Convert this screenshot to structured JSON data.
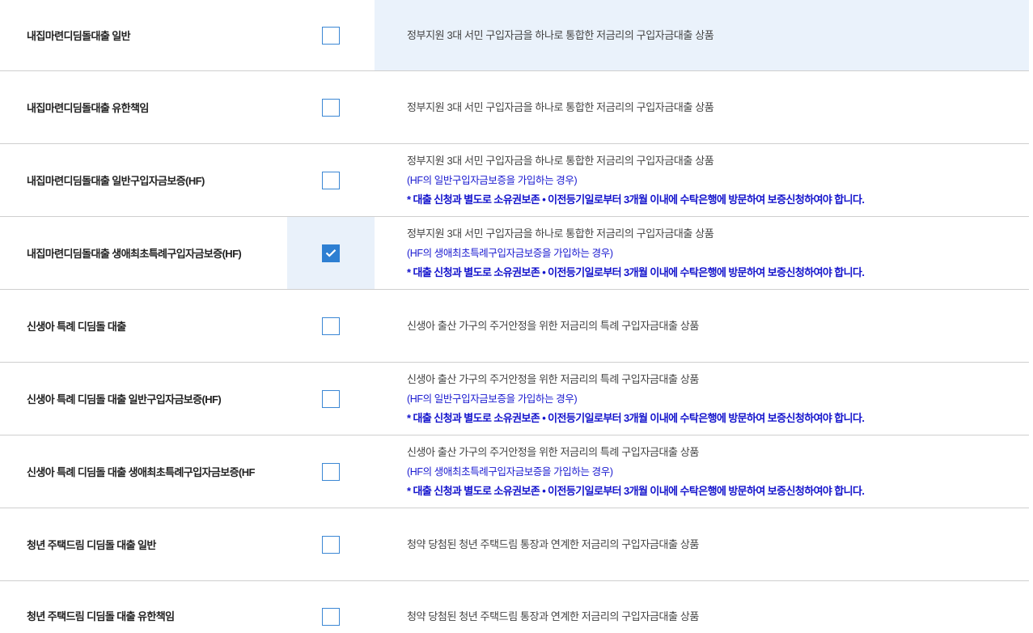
{
  "colors": {
    "accent": "#2e7fd2",
    "note_blue": "#1212cc",
    "highlight_bg": "#eaf2fb",
    "divider": "#cfcfcf"
  },
  "products": [
    {
      "name": "내집마련디딤돌대출 일반",
      "checked": false,
      "description": "정부지원 3대 서민 구입자금을 하나로 통합한 저금리의 구입자금대출 상품"
    },
    {
      "name": "내집마련디딤돌대출 유한책임",
      "checked": false,
      "description": "정부지원 3대 서민 구입자금을 하나로 통합한 저금리의 구입자금대출 상품"
    },
    {
      "name": "내집마련디딤돌대출 일반구입자금보증(HF)",
      "checked": false,
      "description": "정부지원 3대 서민 구입자금을 하나로 통합한 저금리의 구입자금대출 상품",
      "guarantee_note": "(HF의 일반구입자금보증을 가입하는 경우)",
      "notice": "* 대출 신청과 별도로 소유권보존 • 이전등기일로부터 3개월 이내에 수탁은행에 방문하여 보증신청하여야 합니다."
    },
    {
      "name": "내집마련디딤돌대출 생애최초특례구입자금보증(HF)",
      "checked": true,
      "description": "정부지원 3대 서민 구입자금을 하나로 통합한 저금리의 구입자금대출 상품",
      "guarantee_note": "(HF의 생애최초특례구입자금보증을 가입하는 경우)",
      "notice": "* 대출 신청과 별도로 소유권보존 • 이전등기일로부터 3개월 이내에 수탁은행에 방문하여 보증신청하여야 합니다."
    },
    {
      "name": "신생아 특례 디딤돌 대출",
      "checked": false,
      "description": "신생아 출산 가구의 주거안정을 위한 저금리의 특례 구입자금대출 상품"
    },
    {
      "name": "신생아 특례 디딤돌 대출 일반구입자금보증(HF)",
      "checked": false,
      "description": "신생아 출산 가구의 주거안정을 위한 저금리의 특례 구입자금대출 상품",
      "guarantee_note": "(HF의 일반구입자금보증을 가입하는 경우)",
      "notice": "* 대출 신청과 별도로 소유권보존 • 이전등기일로부터 3개월 이내에 수탁은행에 방문하여 보증신청하여야 합니다."
    },
    {
      "name": "신생아 특례 디딤돌 대출 생애최초특례구입자금보증(HF",
      "checked": false,
      "description": "신생아 출산 가구의 주거안정을 위한 저금리의 특례 구입자금대출 상품",
      "guarantee_note": "(HF의 생애최초특례구입자금보증을 가입하는 경우)",
      "notice": "* 대출 신청과 별도로 소유권보존 • 이전등기일로부터 3개월 이내에 수탁은행에 방문하여 보증신청하여야 합니다."
    },
    {
      "name": "청년 주택드림 디딤돌 대출 일반",
      "checked": false,
      "description": "청약 당첨된 청년 주택드림 통장과 연계한 저금리의 구입자금대출 상품"
    },
    {
      "name": "청년 주택드림 디딤돌 대출 유한책임",
      "checked": false,
      "description": "청약 당첨된 청년 주택드림 통장과 연계한 저금리의 구입자금대출 상품"
    }
  ]
}
